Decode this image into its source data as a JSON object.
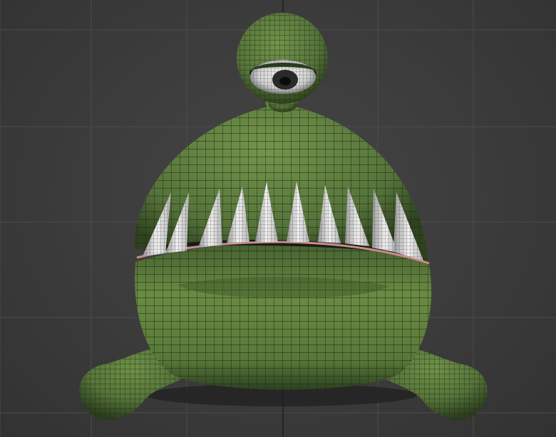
{
  "viewport": {
    "background": "#3b3b3b",
    "grid_color": "#4e4e4e",
    "axis_color": "#1c1c1c",
    "shading": "wireframe-on-shaded"
  },
  "model": {
    "body_color": "#5b7a3a",
    "body_dark": "#24351a",
    "wire_color": "#1a2410",
    "teeth_count": 10,
    "teeth_color": "#e8e8e8",
    "gum_color": "#c98d86",
    "eye_sclera": "#e0e0e0",
    "eye_iris": "#2a2a2a"
  }
}
